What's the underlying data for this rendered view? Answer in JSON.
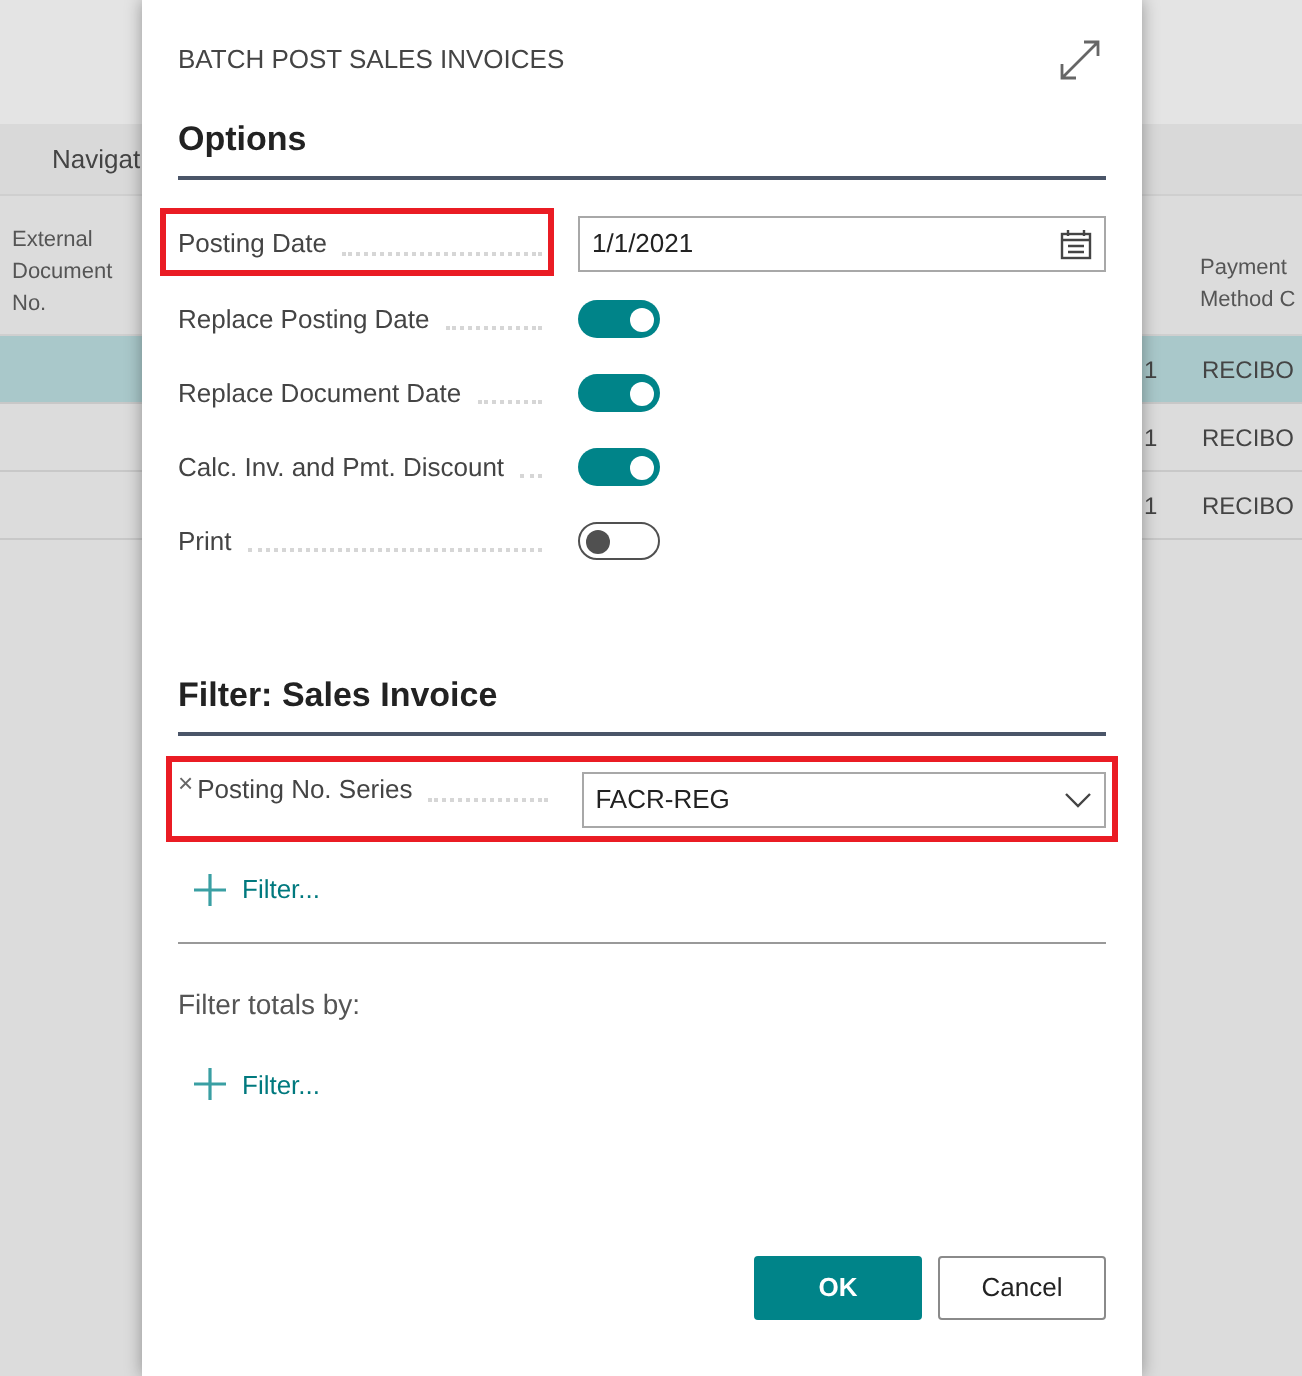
{
  "background": {
    "nav_label": "Navigat",
    "left_column": {
      "header": "External Document No.",
      "rows": [
        {
          "selected": true
        },
        {
          "selected": false
        },
        {
          "selected": false
        }
      ]
    },
    "right_columns": {
      "column_1": [
        "1",
        "1",
        "1"
      ],
      "header": "Payment Method C",
      "rows": [
        {
          "value": "RECIBO",
          "selected": true
        },
        {
          "value": "RECIBO",
          "selected": false
        },
        {
          "value": "RECIBO",
          "selected": false
        }
      ]
    }
  },
  "dialog": {
    "title": "BATCH POST SALES INVOICES",
    "options": {
      "heading": "Options",
      "fields": [
        {
          "kind": "date",
          "label": "Posting Date",
          "value": "1/1/2021",
          "highlighted": true
        },
        {
          "kind": "toggle",
          "label": "Replace Posting Date",
          "on": true
        },
        {
          "kind": "toggle",
          "label": "Replace Document Date",
          "on": true
        },
        {
          "kind": "toggle",
          "label": "Calc. Inv. and Pmt. Discount",
          "on": true
        },
        {
          "kind": "toggle",
          "label": "Print",
          "on": false
        }
      ]
    },
    "filter": {
      "heading": "Filter: Sales Invoice",
      "remove": "×",
      "fields": [
        {
          "label": "Posting No. Series",
          "value": "FACR-REG",
          "highlighted": true
        }
      ],
      "add_filter": "Filter..."
    },
    "totals": {
      "label": "Filter totals by:",
      "add_filter": "Filter..."
    },
    "buttons": [
      {
        "label": "OK",
        "kind": "primary"
      },
      {
        "label": "Cancel",
        "kind": "secondary"
      }
    ]
  }
}
